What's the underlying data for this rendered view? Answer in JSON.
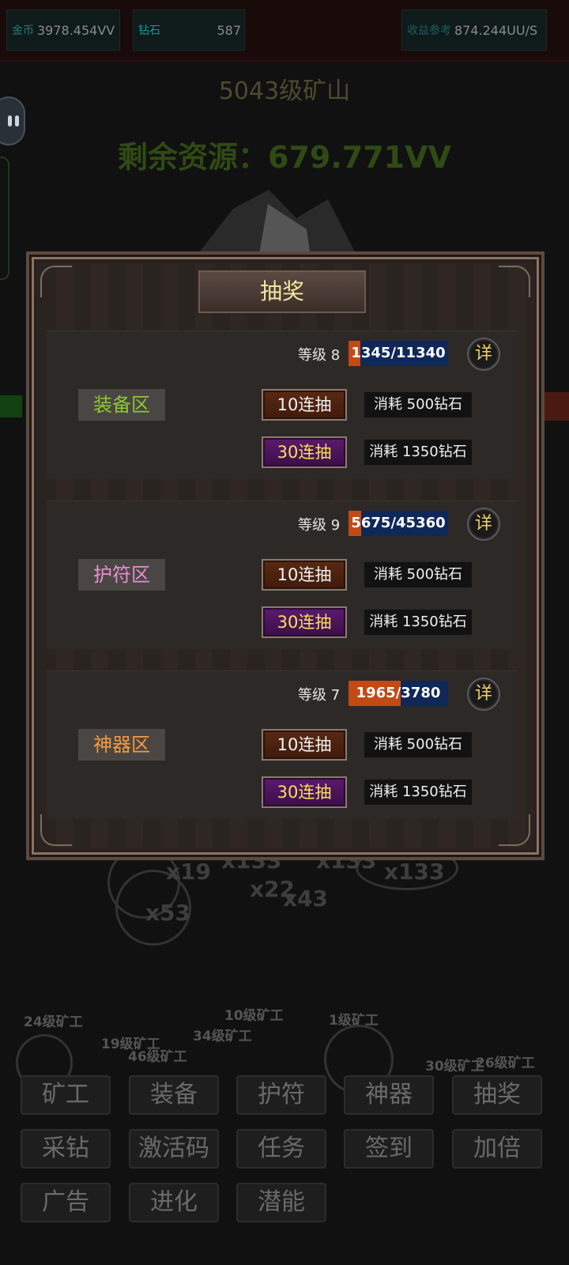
{
  "topbar": {
    "gold_label": "金币",
    "gold_value": "3978.454VV",
    "diamond_label": "钻石",
    "diamond_value": "587",
    "income_label": "收益参考",
    "income_value": "874.244UU/S"
  },
  "mine": {
    "title": "5043级矿山",
    "remaining": "剩余资源：679.771VV"
  },
  "background": {
    "multipliers": [
      "x19",
      "x133",
      "x133",
      "x22",
      "x133",
      "x43",
      "x53"
    ],
    "miner_labels": [
      "24级矿工",
      "10级矿工",
      "1级矿工",
      "19级矿工",
      "34级矿工",
      "46级矿工",
      "30级矿工",
      "26级矿工"
    ]
  },
  "dialog": {
    "title": "抽奖",
    "zones": [
      {
        "name": "装备区",
        "name_color": "#8cc832",
        "level_text": "等级 8",
        "progress_text": "1345/11340",
        "progress_fraction": 0.119,
        "detail_label": "详",
        "ten_label": "10连抽",
        "ten_cost": "消耗 500钻石",
        "thirty_label": "30连抽",
        "thirty_cost": "消耗 1350钻石"
      },
      {
        "name": "护符区",
        "name_color": "#e98fcf",
        "level_text": "等级 9",
        "progress_text": "5675/45360",
        "progress_fraction": 0.125,
        "detail_label": "详",
        "ten_label": "10连抽",
        "ten_cost": "消耗 500钻石",
        "thirty_label": "30连抽",
        "thirty_cost": "消耗 1350钻石"
      },
      {
        "name": "神器区",
        "name_color": "#f59a3c",
        "level_text": "等级 7",
        "progress_text": "1965/3780",
        "progress_fraction": 0.52,
        "detail_label": "详",
        "ten_label": "10连抽",
        "ten_cost": "消耗 500钻石",
        "thirty_label": "30连抽",
        "thirty_cost": "消耗 1350钻石"
      }
    ]
  },
  "menu": [
    [
      "矿工",
      "装备",
      "护符",
      "神器",
      "抽奖"
    ],
    [
      "采钻",
      "激活码",
      "任务",
      "签到",
      "加倍"
    ],
    [
      "广告",
      "进化",
      "潜能"
    ]
  ]
}
